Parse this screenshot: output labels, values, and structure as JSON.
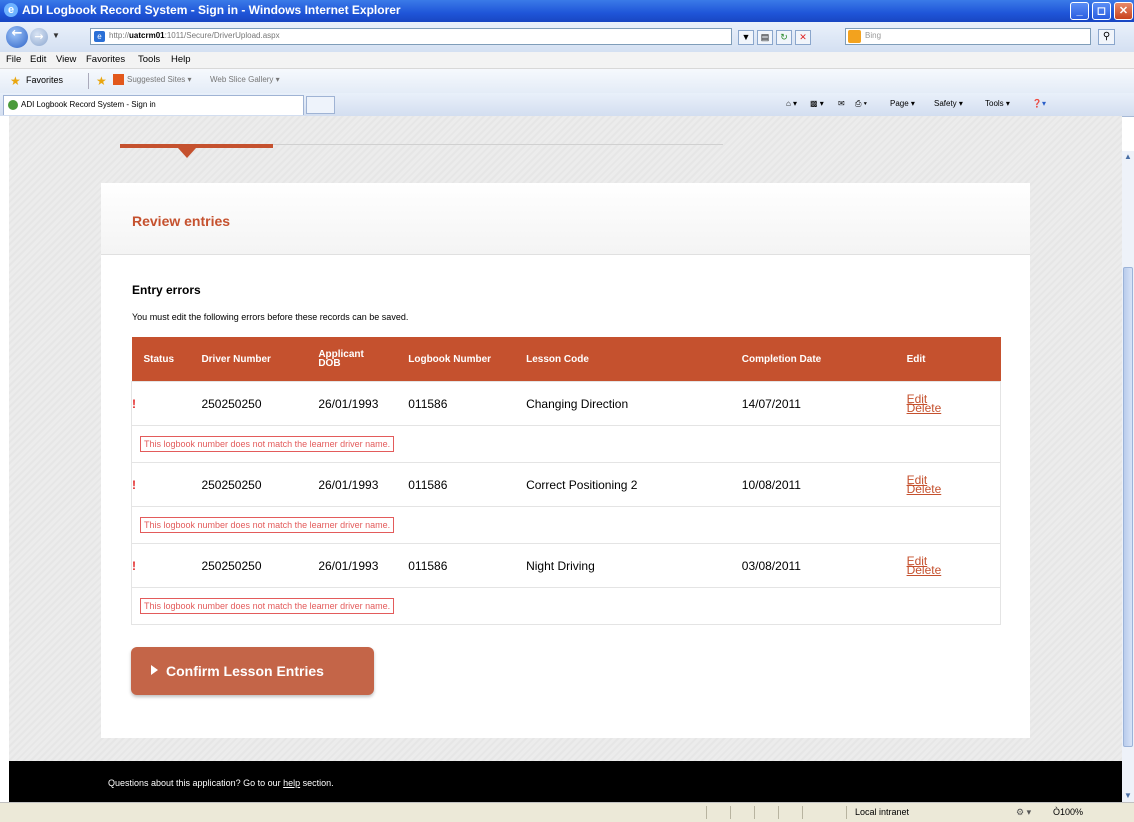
{
  "window": {
    "title": "ADI Logbook Record System - Sign in - Windows Internet Explorer"
  },
  "address_bar": {
    "url_prefix": "http://",
    "url_host": "uatcrm01",
    "url_rest": ":1011/Secure/DriverUpload.aspx",
    "search_placeholder": "Bing"
  },
  "menu": [
    "File",
    "Edit",
    "View",
    "Favorites",
    "Tools",
    "Help"
  ],
  "favorites_bar": {
    "label": "Favorites",
    "items": [
      "Suggested Sites ▾",
      "Web Slice Gallery ▾"
    ]
  },
  "tab": {
    "label": "ADI Logbook Record System - Sign in"
  },
  "command_bar": {
    "page": "Page ▾",
    "safety": "Safety ▾",
    "tools": "Tools ▾"
  },
  "page": {
    "panel_title": "Review entries",
    "errors_title": "Entry errors",
    "errors_message": "You must edit the following errors before these records can be saved.",
    "table": {
      "headers": {
        "status": "Status",
        "driver_number": "Driver Number",
        "applicant_dob_1": "Applicant",
        "applicant_dob_2": "DOB",
        "logbook_number": "Logbook Number",
        "lesson_code": "Lesson Code",
        "completion_date": "Completion Date",
        "edit": "Edit"
      },
      "rows": [
        {
          "status": "!",
          "driver_number": "250250250",
          "applicant_dob": "26/01/1993",
          "logbook_number": "011586",
          "lesson_code": "Changing Direction",
          "completion_date": "14/07/2011",
          "edit": "Edit",
          "delete": "Delete",
          "error": "This logbook number does not match the learner driver name."
        },
        {
          "status": "!",
          "driver_number": "250250250",
          "applicant_dob": "26/01/1993",
          "logbook_number": "011586",
          "lesson_code": "Correct Positioning 2",
          "completion_date": "10/08/2011",
          "edit": "Edit",
          "delete": "Delete",
          "error": "This logbook number does not match the learner driver name."
        },
        {
          "status": "!",
          "driver_number": "250250250",
          "applicant_dob": "26/01/1993",
          "logbook_number": "011586",
          "lesson_code": "Night Driving",
          "completion_date": "03/08/2011",
          "edit": "Edit",
          "delete": "Delete",
          "error": "This logbook number does not match the learner driver name."
        }
      ]
    },
    "confirm_button": "Confirm Lesson Entries",
    "footer": {
      "text_before": "Questions about this application? Go to our ",
      "help_link": "help",
      "text_after": " section."
    }
  },
  "status_bar": {
    "zone": "Local intranet",
    "zoom": "Ò100%",
    "protected": "▾"
  },
  "colors": {
    "accent": "#c5512e",
    "button": "#c46548",
    "error": "#e32c2c",
    "footer": "#000000",
    "titlebar": "#1f55d8"
  }
}
